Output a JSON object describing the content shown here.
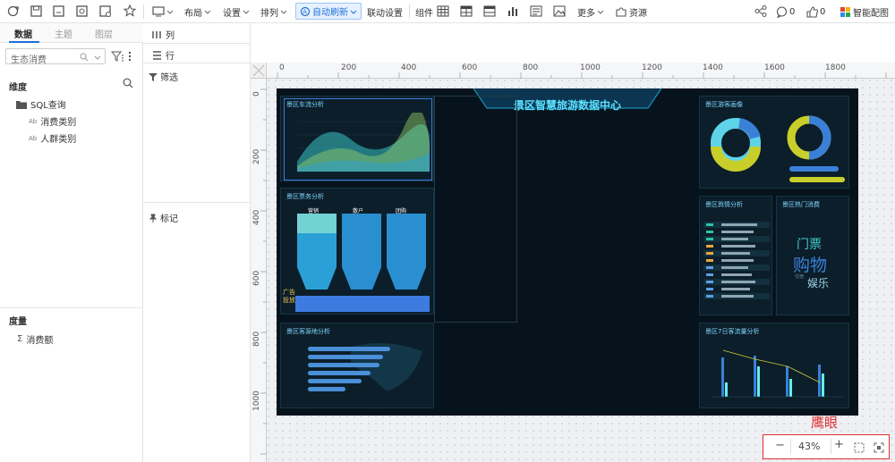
{
  "toolbar": {
    "layout": "布局",
    "settings": "设置",
    "arrange": "排列",
    "auto_refresh": "自动刷新",
    "linkage": "联动设置",
    "component": "组件",
    "more": "更多",
    "resource": "资源",
    "comment_count": "0",
    "like_count": "0",
    "smart_map": "智能配图"
  },
  "left_panel": {
    "tabs": [
      "数据",
      "主题",
      "图层"
    ],
    "dataset": "生态消费",
    "dimension_title": "维度",
    "sql_item": "SQL查询",
    "dimensions": [
      "消费类别",
      "人群类别"
    ],
    "measure_title": "度量",
    "measures": [
      "消费额"
    ]
  },
  "mid_panel": {
    "column": "列",
    "row": "行",
    "filter": "筛选",
    "mark": "标记"
  },
  "ruler": {
    "h_ticks": [
      "0",
      "200",
      "400",
      "600",
      "800",
      "1000",
      "1200",
      "1400",
      "1600",
      "1800"
    ],
    "v_ticks": [
      "0",
      "200",
      "400",
      "600",
      "800",
      "1000"
    ]
  },
  "dashboard": {
    "title": "景区智慧旅游数据中心",
    "car_flow": "景区车流分析",
    "ticket": "景区票务分析",
    "source": "景区客源地分析",
    "visitor_profile": "景区游客画像",
    "sentiment": "景区舆情分析",
    "hot_consume": "景区热门消费",
    "seven_day": "景区7日客流量分析",
    "ticket_cols": [
      "营销",
      "散户",
      "团购"
    ],
    "hot_words": [
      "门票",
      "购物",
      "娱乐",
      "住宿"
    ],
    "side_text": [
      "广告",
      "投放"
    ]
  },
  "hawk_eye": "鹰眼",
  "zoom": {
    "minus": "−",
    "value": "43%",
    "plus": "+"
  },
  "colors": {
    "accent": "#1e6fd9",
    "red": "#e03030"
  }
}
